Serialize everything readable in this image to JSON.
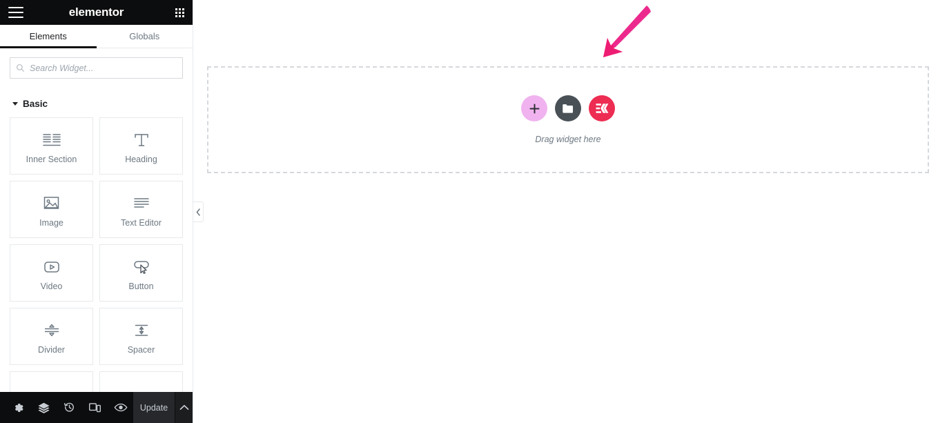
{
  "panel": {
    "header": {
      "menu_icon": "hamburger-icon",
      "brand": "elementor",
      "apps_icon": "grid-apps-icon"
    },
    "tabs": [
      {
        "label": "Elements",
        "active": true
      },
      {
        "label": "Globals",
        "active": false
      }
    ],
    "search": {
      "placeholder": "Search Widget...",
      "value": "",
      "icon": "search-icon"
    },
    "sections": [
      {
        "title": "Basic",
        "expanded": true,
        "widgets": [
          {
            "label": "Inner Section",
            "icon": "inner-section-icon"
          },
          {
            "label": "Heading",
            "icon": "heading-icon"
          },
          {
            "label": "Image",
            "icon": "image-icon"
          },
          {
            "label": "Text Editor",
            "icon": "text-editor-icon"
          },
          {
            "label": "Video",
            "icon": "video-icon"
          },
          {
            "label": "Button",
            "icon": "button-icon"
          },
          {
            "label": "Divider",
            "icon": "divider-icon"
          },
          {
            "label": "Spacer",
            "icon": "spacer-icon"
          }
        ]
      }
    ],
    "footer": {
      "icons": [
        {
          "name": "settings-gear-icon",
          "title": "Settings"
        },
        {
          "name": "navigator-layers-icon",
          "title": "Navigator"
        },
        {
          "name": "history-clock-icon",
          "title": "History"
        },
        {
          "name": "responsive-device-icon",
          "title": "Responsive Mode"
        },
        {
          "name": "preview-eye-icon",
          "title": "Preview Changes"
        }
      ],
      "update_label": "Update",
      "chevron_icon": "chevron-up-icon"
    },
    "collapse_icon": "chevron-left-icon"
  },
  "canvas": {
    "drop_zone": {
      "drag_label": "Drag widget here",
      "buttons": [
        {
          "name": "add-section-button",
          "icon": "plus-icon",
          "color": "#f0b3ef"
        },
        {
          "name": "add-template-button",
          "icon": "folder-icon",
          "color": "#495157"
        },
        {
          "name": "ek-addons-button",
          "icon": "ek-logo-icon",
          "color": "#ed2d52"
        }
      ]
    },
    "annotation": {
      "arrow": "pink-arrow-pointing-to-ek-button",
      "color": "#ed1e79"
    }
  }
}
